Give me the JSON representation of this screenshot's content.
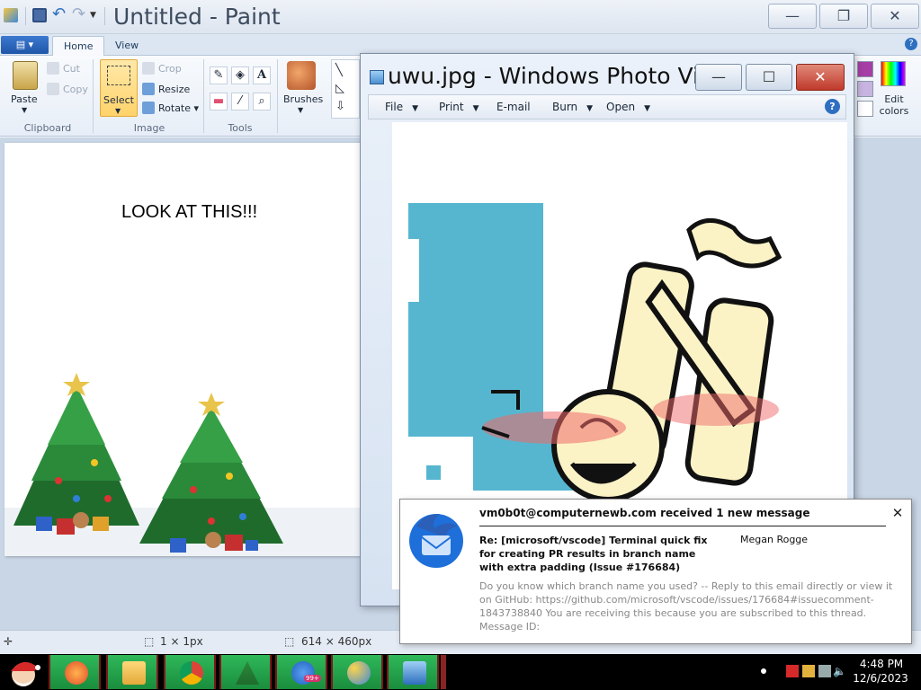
{
  "paint": {
    "title": "Untitled - Paint",
    "tabs": {
      "home": "Home",
      "view": "View"
    },
    "clipboard": {
      "paste": "Paste",
      "cut": "Cut",
      "copy": "Copy",
      "label": "Clipboard"
    },
    "image": {
      "select": "Select",
      "crop": "Crop",
      "resize": "Resize",
      "rotate": "Rotate",
      "label": "Image"
    },
    "tools": {
      "label": "Tools",
      "text_tool": "A"
    },
    "brushes": "Brushes",
    "colors": {
      "edit": "Edit colors",
      "swatch1": "#a63ea6",
      "swatch2": "#c8b4e0"
    },
    "canvas": {
      "text": "LOOK AT THIS!!!"
    },
    "status": {
      "cursor_size": "1 × 1px",
      "image_size": "614 × 460px"
    }
  },
  "viewer": {
    "title": "uwu.jpg - Windows Photo Vi...",
    "menu": {
      "file": "File",
      "print": "Print",
      "email": "E-mail",
      "burn": "Burn",
      "open": "Open"
    },
    "help": "?"
  },
  "notification": {
    "header": "vm0b0t@computernewb.com received 1 new message",
    "subject": "Re: [microsoft/vscode] Terminal quick fix for creating PR results in branch name with extra padding (Issue #176684)",
    "from": "Megan Rogge",
    "body": "Do you know which branch name you used? -- Reply to this email directly or view it on GitHub: https://github.com/microsoft/vscode/issues/176684#issuecomment-1843738840 You are receiving this because you are subscribed to this thread. Message ID:"
  },
  "taskbar": {
    "badge": "99+",
    "time": "4:48 PM",
    "date": "12/6/2023"
  }
}
